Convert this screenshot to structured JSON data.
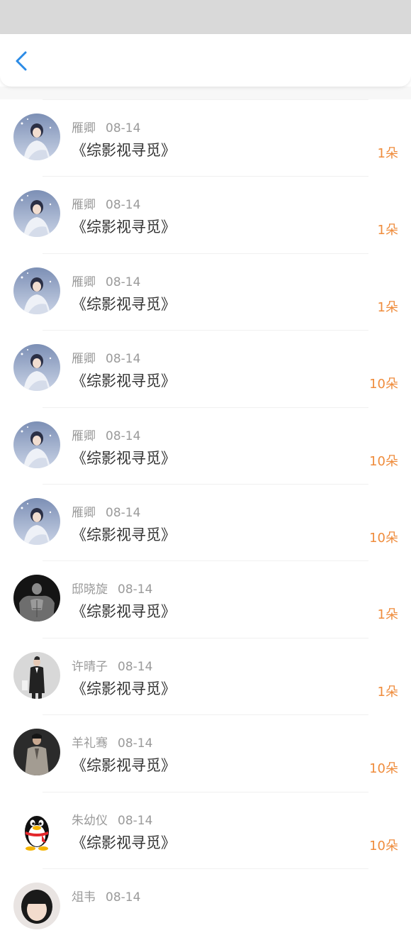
{
  "colors": {
    "status_bar": "#d9d9d9",
    "back_icon": "#2b8be6",
    "name_text": "#9a9a9a",
    "title_text": "#333333",
    "gift_text": "#ef8c3c"
  },
  "nav": {
    "back_icon": "chevron-left-icon"
  },
  "records": [
    {
      "name": "雁卿",
      "date": "08-14",
      "title": "《综影视寻觅》",
      "gift": "1朵",
      "avatar": "woman-portrait"
    },
    {
      "name": "雁卿",
      "date": "08-14",
      "title": "《综影视寻觅》",
      "gift": "1朵",
      "avatar": "woman-portrait"
    },
    {
      "name": "雁卿",
      "date": "08-14",
      "title": "《综影视寻觅》",
      "gift": "1朵",
      "avatar": "woman-portrait"
    },
    {
      "name": "雁卿",
      "date": "08-14",
      "title": "《综影视寻觅》",
      "gift": "10朵",
      "avatar": "woman-portrait"
    },
    {
      "name": "雁卿",
      "date": "08-14",
      "title": "《综影视寻觅》",
      "gift": "10朵",
      "avatar": "woman-portrait"
    },
    {
      "name": "雁卿",
      "date": "08-14",
      "title": "《综影视寻觅》",
      "gift": "10朵",
      "avatar": "woman-portrait"
    },
    {
      "name": "邸晓旋",
      "date": "08-14",
      "title": "《综影视寻觅》",
      "gift": "1朵",
      "avatar": "muscle-man-portrait"
    },
    {
      "name": "许晴子",
      "date": "08-14",
      "title": "《综影视寻觅》",
      "gift": "1朵",
      "avatar": "suit-man-portrait"
    },
    {
      "name": "羊礼骞",
      "date": "08-14",
      "title": "《综影视寻觅》",
      "gift": "10朵",
      "avatar": "coat-man-portrait"
    },
    {
      "name": "朱幼仪",
      "date": "08-14",
      "title": "《综影视寻觅》",
      "gift": "10朵",
      "avatar": "qq-penguin"
    },
    {
      "name": "俎韦",
      "date": "08-14",
      "title": "",
      "gift": "",
      "avatar": "girl-portrait"
    }
  ]
}
